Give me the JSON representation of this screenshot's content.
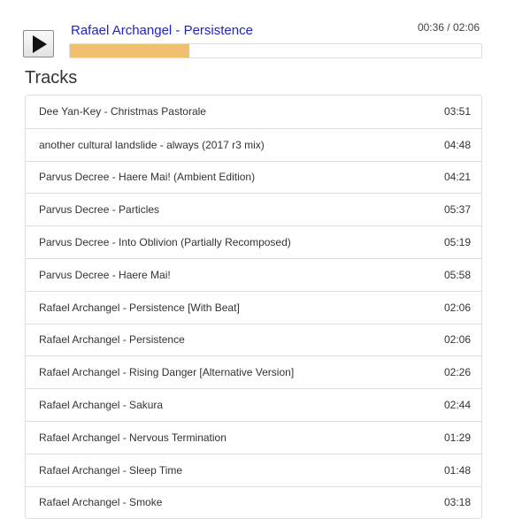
{
  "player": {
    "play_icon": "play-icon",
    "now_playing": "Rafael Archangel - Persistence",
    "time": "00:36 / 02:06",
    "progress": 0.29,
    "progress_color": "#f0c070",
    "title_color": "#2222cc"
  },
  "tracks": {
    "heading": "Tracks",
    "items": [
      {
        "name": "Dee Yan-Key - Christmas Pastorale",
        "duration": "03:51"
      },
      {
        "name": "another cultural landslide - always (2017 r3 mix)",
        "duration": "04:48"
      },
      {
        "name": "Parvus Decree - Haere Mai! (Ambient Edition)",
        "duration": "04:21"
      },
      {
        "name": "Parvus Decree - Particles",
        "duration": "05:37"
      },
      {
        "name": "Parvus Decree - Into Oblivion (Partially Recomposed)",
        "duration": "05:19"
      },
      {
        "name": "Parvus Decree - Haere Mai!",
        "duration": "05:58"
      },
      {
        "name": "Rafael Archangel - Persistence [With Beat]",
        "duration": "02:06"
      },
      {
        "name": "Rafael Archangel - Persistence",
        "duration": "02:06"
      },
      {
        "name": "Rafael Archangel - Rising Danger [Alternative Version]",
        "duration": "02:26"
      },
      {
        "name": "Rafael Archangel - Sakura",
        "duration": "02:44"
      },
      {
        "name": "Rafael Archangel - Nervous Termination",
        "duration": "01:29"
      },
      {
        "name": "Rafael Archangel - Sleep Time",
        "duration": "01:48"
      },
      {
        "name": "Rafael Archangel - Smoke",
        "duration": "03:18"
      }
    ]
  }
}
